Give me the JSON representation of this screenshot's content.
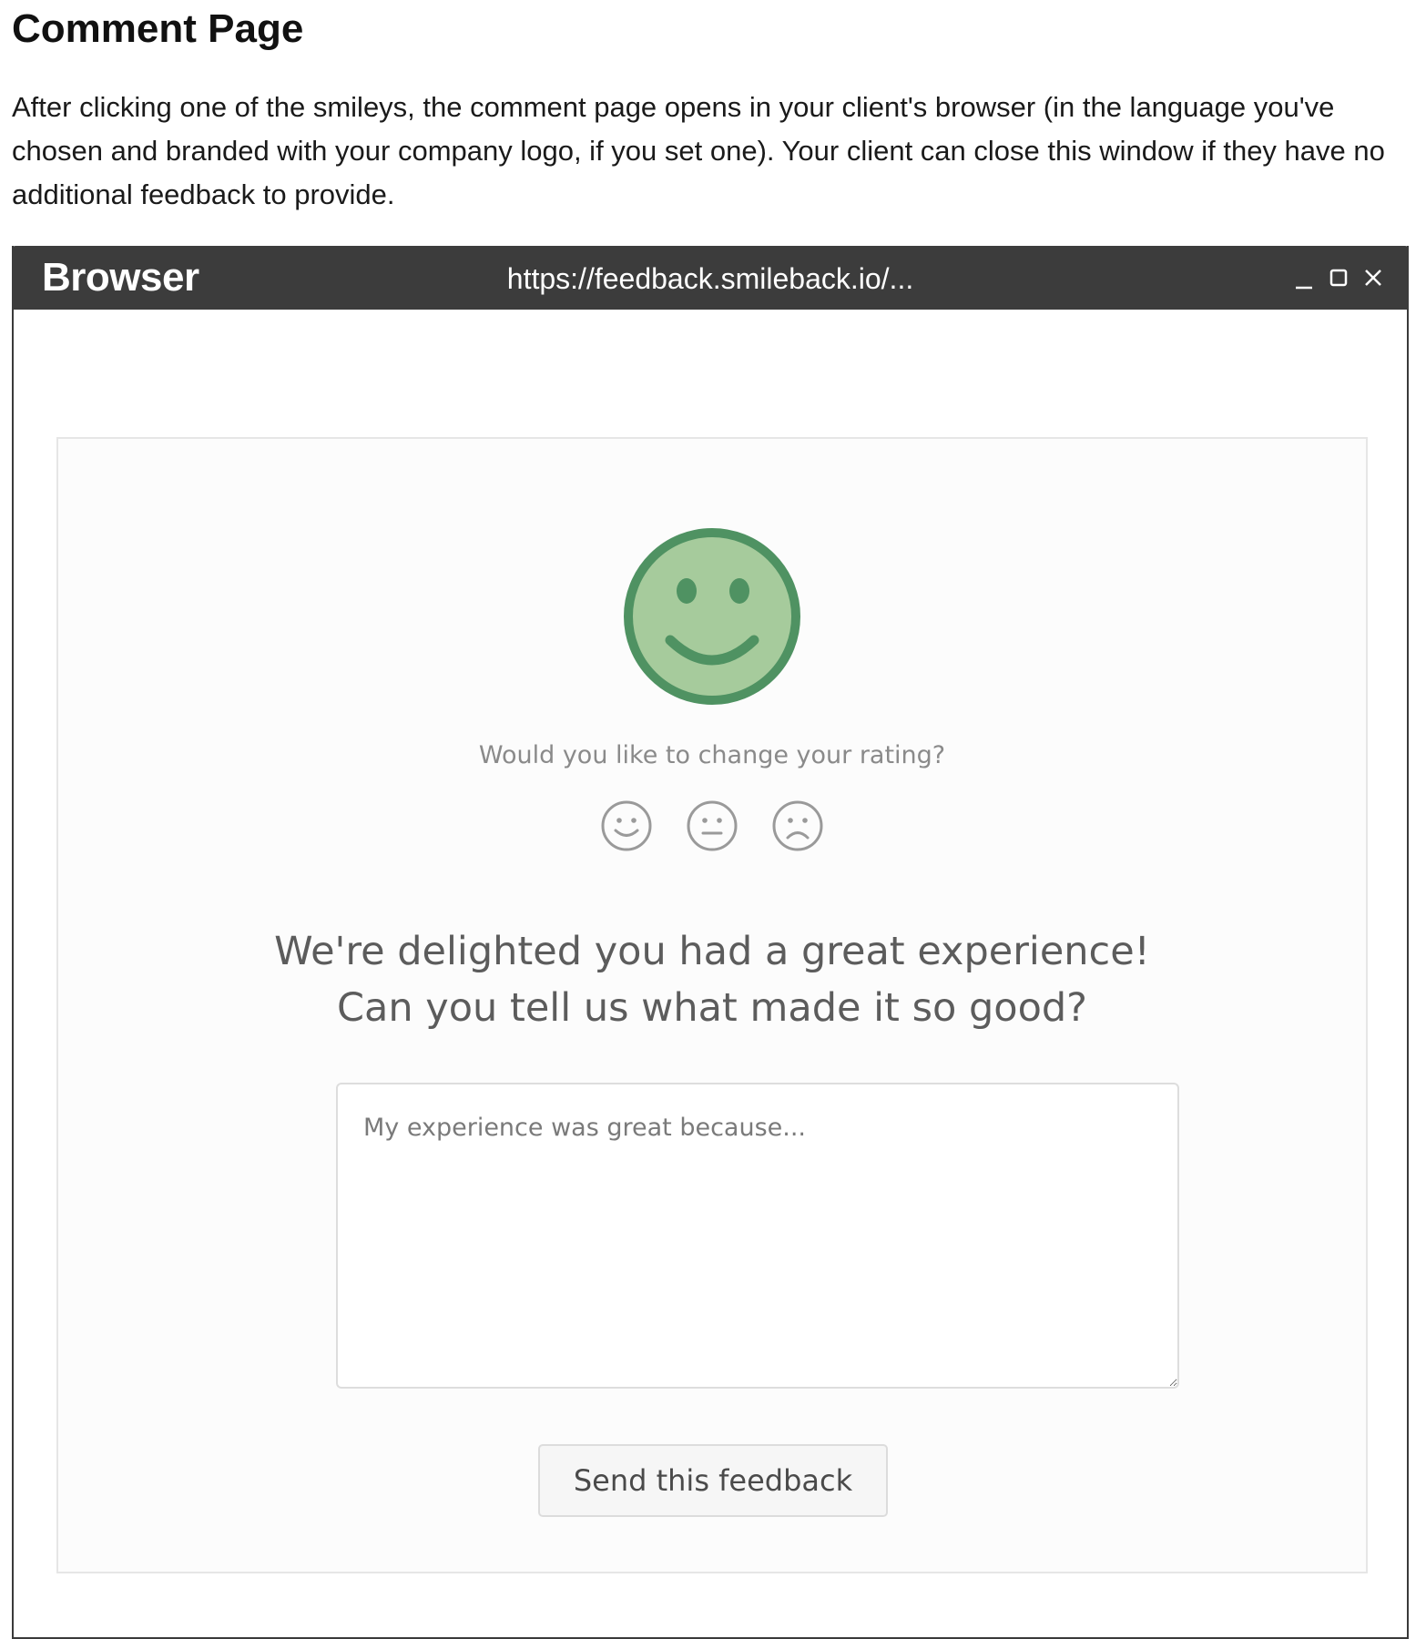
{
  "article": {
    "title": "Comment Page",
    "intro": "After clicking one of the smileys, the comment page opens in your client's browser (in the language you've chosen and branded with your company logo, if you set one). Your client can close this window if they have no additional feedback to provide."
  },
  "browser": {
    "brand": "Browser",
    "url": "https://feedback.smileback.io/...",
    "controls": [
      "minimize-icon",
      "maximize-icon",
      "close-icon"
    ]
  },
  "feedback": {
    "selected_rating_icon": "happy-face-icon",
    "accent_color": "#4f9262",
    "accent_fill": "#a6cb9c",
    "change_question": "Would you like to change your rating?",
    "rating_options": [
      "happy-face-icon",
      "neutral-face-icon",
      "sad-face-icon"
    ],
    "headline_line1": "We're delighted you had a great experience!",
    "headline_line2": "Can you tell us what made it so good?",
    "comment_placeholder": "My experience was great because...",
    "comment_value": "",
    "send_label": "Send this feedback"
  }
}
